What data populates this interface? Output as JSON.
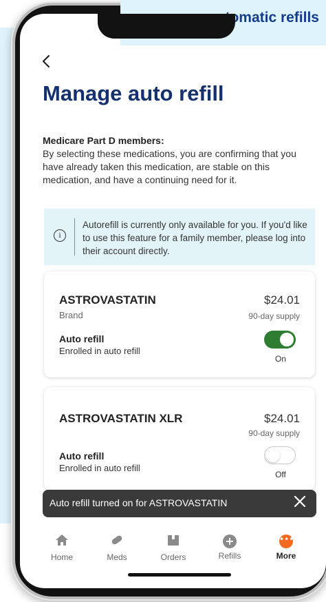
{
  "banner": {
    "text": "automatic refills"
  },
  "header": {
    "back_icon": "chevron-left-icon",
    "title": "Manage auto refill"
  },
  "notice": {
    "heading": "Medicare Part D members:",
    "body": "By selecting these medications, you are confirming that you have already taken this medication, are stable on this medication, and have a continuing need for it."
  },
  "info": {
    "icon": "info-icon",
    "text": "Autorefill is currently only available for you. If you'd like to use this feature for a family member, please log into their account directly."
  },
  "medications": [
    {
      "name": "ASTROVASTATIN",
      "type": "Brand",
      "price": "$24.01",
      "supply": "90-day supply",
      "auto_label": "Auto refill",
      "status": "Enrolled in auto refill",
      "toggle": "On",
      "enabled": true
    },
    {
      "name": "ASTROVASTATIN XLR",
      "type": "",
      "price": "$24.01",
      "supply": "90-day supply",
      "auto_label": "Auto refill",
      "status": "Enrolled in auto refill",
      "toggle": "Off",
      "enabled": false
    }
  ],
  "toast": {
    "text": "Auto refill turned on for ASTROVASTATIN",
    "close_icon": "close-icon"
  },
  "tabbar": [
    {
      "label": "Home",
      "icon": "home-icon",
      "active": false
    },
    {
      "label": "Meds",
      "icon": "pill-icon",
      "active": false
    },
    {
      "label": "Orders",
      "icon": "box-icon",
      "active": false
    },
    {
      "label": "Refills",
      "icon": "plus-circle-icon",
      "active": false
    },
    {
      "label": "More",
      "icon": "more-icon",
      "active": true
    }
  ],
  "colors": {
    "title": "#14306e",
    "toggle_on": "#2e7d32",
    "info_bg": "#e3f4f9",
    "toast_bg": "#3a3a3a",
    "more_accent": "#f26a21"
  }
}
